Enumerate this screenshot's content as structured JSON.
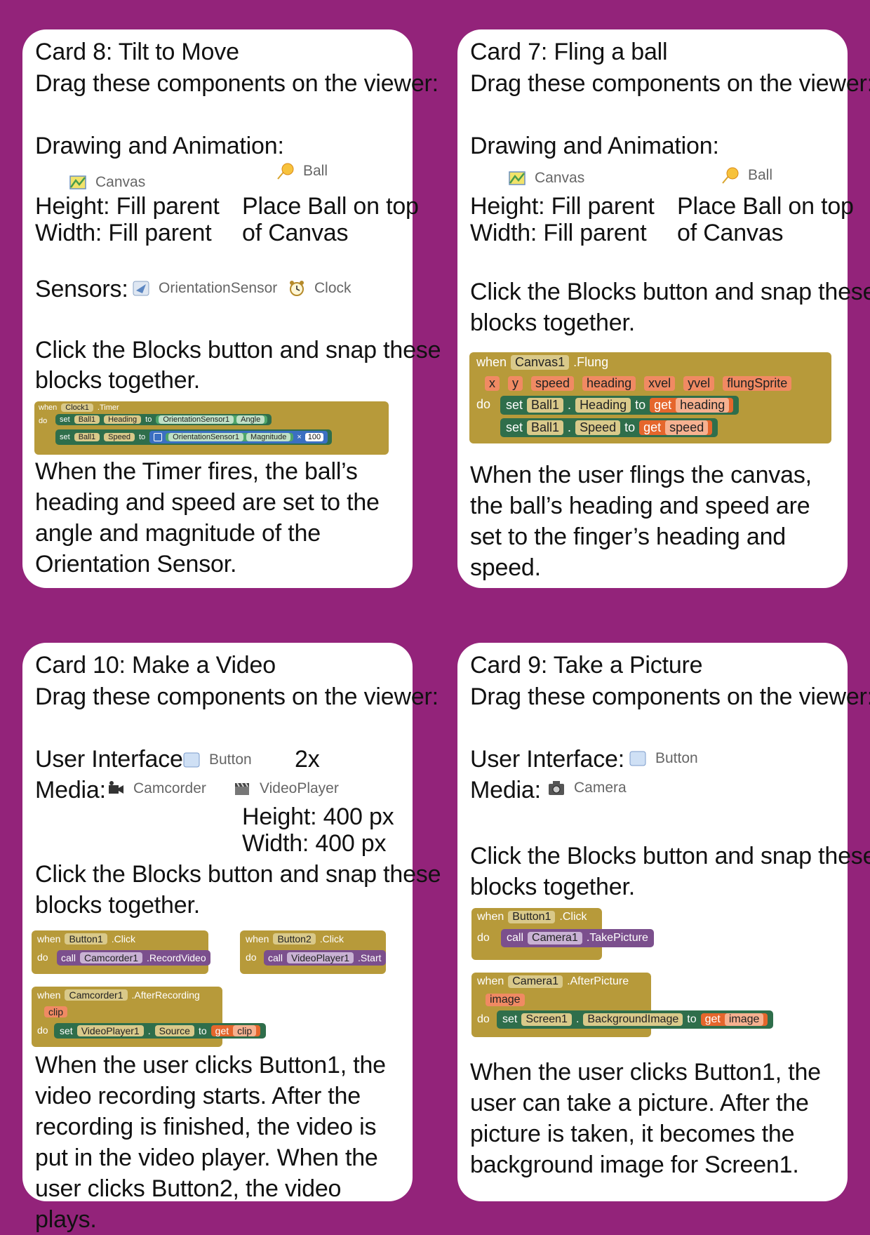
{
  "cards": [
    {
      "title": "Card 8: Tilt to Move",
      "intro": "Drag these components on the viewer:",
      "section1": "Drawing and Animation:",
      "comp_canvas": "Canvas",
      "comp_ball": "Ball",
      "canvas_height": "Height: Fill parent",
      "canvas_width": "Width: Fill parent",
      "ball_note1": "Place Ball on top",
      "ball_note2": "of Canvas",
      "section2": "Sensors:",
      "comp_orient": "OrientationSensor",
      "comp_clock": "Clock",
      "blocks_line1": "Click the Blocks button and snap these",
      "blocks_line2": "blocks together.",
      "code": {
        "when": "when",
        "component": "Clock1",
        "event": ".Timer",
        "do": "do",
        "set": "set",
        "to": "to",
        "row1": {
          "comp": "Ball1",
          "prop": "Heading",
          "src": "OrientationSensor1",
          "srcprop": "Angle"
        },
        "row2": {
          "comp": "Ball1",
          "prop": "Speed",
          "src": "OrientationSensor1",
          "srcprop": "Magnitude",
          "op": "×",
          "num": "100"
        }
      },
      "description": "When the Timer fires, the ball’s heading and speed are set to the angle and magnitude of the Orientation Sensor."
    },
    {
      "title": "Card 7: Fling a ball",
      "intro": "Drag these components on the viewer:",
      "section1": "Drawing and Animation:",
      "comp_canvas": "Canvas",
      "comp_ball": "Ball",
      "canvas_height": "Height: Fill parent",
      "canvas_width": "Width: Fill parent",
      "ball_note1": "Place Ball on top",
      "ball_note2": "of Canvas",
      "blocks_line1": "Click the Blocks button and snap these",
      "blocks_line2": "blocks together.",
      "code": {
        "when": "when",
        "component": "Canvas1",
        "event": ".Flung",
        "do": "do",
        "params": [
          "x",
          "y",
          "speed",
          "heading",
          "xvel",
          "yvel",
          "flungSprite"
        ],
        "set": "set",
        "to": "to",
        "get": "get",
        "row1": {
          "comp": "Ball1",
          "prop": "Heading",
          "var": "heading"
        },
        "row2": {
          "comp": "Ball1",
          "prop": "Speed",
          "var": "speed"
        }
      },
      "description": "When the user flings the canvas, the ball’s heading and speed are set to the finger’s heading and speed."
    },
    {
      "title": "Card 10: Make a Video",
      "intro": "Drag these components on the viewer:",
      "ui_label": "User Interface:",
      "comp_button": "Button",
      "count": "2x",
      "media_label": "Media:",
      "comp_camcorder": "Camcorder",
      "comp_videoplayer": "VideoPlayer",
      "vp_height": "Height: 400 px",
      "vp_width": "Width: 400 px",
      "blocks_line1": "Click the Blocks button and snap these",
      "blocks_line2": "blocks together.",
      "code": {
        "when": "when",
        "do": "do",
        "call": "call",
        "set": "set",
        "to": "to",
        "get": "get",
        "b1": {
          "component": "Button1",
          "event": ".Click",
          "target": "Camcorder1",
          "method": ".RecordVideo"
        },
        "b2": {
          "component": "Button2",
          "event": ".Click",
          "target": "VideoPlayer1",
          "method": ".Start"
        },
        "b3": {
          "component": "Camcorder1",
          "event": ".AfterRecording",
          "param": "clip",
          "setcomp": "VideoPlayer1",
          "prop": "Source",
          "var": "clip"
        }
      },
      "description": "When the user clicks Button1, the video recording starts. After the recording is finished, the video is put in the video player. When the user clicks Button2, the video plays."
    },
    {
      "title": "Card 9: Take a Picture",
      "intro": "Drag these components on the viewer:",
      "ui_label": "User Interface:",
      "comp_button": "Button",
      "media_label": "Media:",
      "comp_camera": "Camera",
      "blocks_line1": "Click the Blocks button and snap these",
      "blocks_line2": "blocks together.",
      "code": {
        "when": "when",
        "do": "do",
        "call": "call",
        "set": "set",
        "to": "to",
        "get": "get",
        "b1": {
          "component": "Button1",
          "event": ".Click",
          "target": "Camera1",
          "method": ".TakePicture"
        },
        "b2": {
          "component": "Camera1",
          "event": ".AfterPicture",
          "param": "image",
          "setcomp": "Screen1",
          "prop": "BackgroundImage",
          "var": "image"
        }
      },
      "description": "When the user clicks Button1, the user can take a picture. After the picture is taken, it becomes the background image for Screen1."
    }
  ],
  "colors": {
    "background": "#93237a",
    "event_block": "#b79a3a",
    "set_block": "#2f6e4b",
    "get_block": "#e5662c",
    "call_block": "#7b4f8d"
  }
}
